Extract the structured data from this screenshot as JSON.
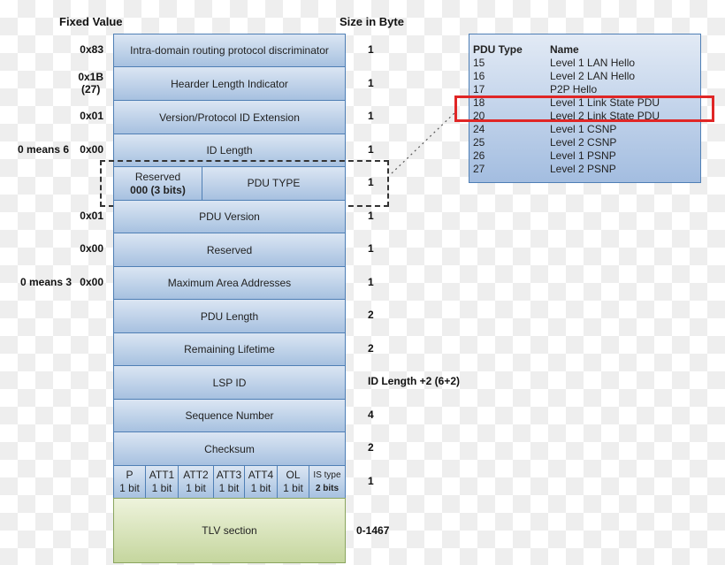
{
  "headers": {
    "fixed_value": "Fixed Value",
    "size_in_byte": "Size in Byte"
  },
  "fields": [
    {
      "name": "Intra-domain routing protocol discriminator",
      "fixed": "0x83",
      "size": "1"
    },
    {
      "name": "Hearder Length Indicator",
      "fixed": "0x1B",
      "fixed_sub": "(27)",
      "size": "1"
    },
    {
      "name": "Version/Protocol ID Extension",
      "fixed": "0x01",
      "size": "1"
    },
    {
      "name": "ID Length",
      "fixed": "0x00",
      "note": "0 means 6",
      "size": "1"
    },
    {
      "name": "PDU TYPE",
      "reserved_label": "Reserved",
      "reserved_value": "000 (3 bits)",
      "size": "1"
    },
    {
      "name": "PDU Version",
      "fixed": "0x01",
      "size": "1"
    },
    {
      "name": "Reserved",
      "fixed": "0x00",
      "size": "1"
    },
    {
      "name": "Maximum Area Addresses",
      "fixed": "0x00",
      "note": "0 means 3",
      "size": "1"
    },
    {
      "name": "PDU Length",
      "size": "2"
    },
    {
      "name": "Remaining Lifetime",
      "size": "2"
    },
    {
      "name": "LSP ID",
      "size": "ID Length +2 (6+2)"
    },
    {
      "name": "Sequence Number",
      "size": "4"
    },
    {
      "name": "Checksum",
      "size": "2"
    }
  ],
  "bit_fields": {
    "size": "1",
    "cells": [
      {
        "name": "P",
        "bits": "1 bit"
      },
      {
        "name": "ATT1",
        "bits": "1 bit"
      },
      {
        "name": "ATT2",
        "bits": "1 bit"
      },
      {
        "name": "ATT3",
        "bits": "1 bit"
      },
      {
        "name": "ATT4",
        "bits": "1 bit"
      },
      {
        "name": "OL",
        "bits": "1 bit"
      },
      {
        "name": "IS type",
        "bits": "2 bits"
      }
    ]
  },
  "tlv": {
    "name": "TLV section",
    "size": "0-1467"
  },
  "pdu_table": {
    "headers": [
      "PDU Type",
      "Name"
    ],
    "rows": [
      [
        "15",
        "Level 1 LAN Hello"
      ],
      [
        "16",
        "Level 2 LAN Hello"
      ],
      [
        "17",
        "P2P Hello"
      ],
      [
        "18",
        "Level 1 Link State PDU"
      ],
      [
        "20",
        "Level 2 Link State PDU"
      ],
      [
        "24",
        "Level 1 CSNP"
      ],
      [
        "25",
        "Level 2 CSNP"
      ],
      [
        "26",
        "Level 1 PSNP"
      ],
      [
        "27",
        "Level 2 PSNP"
      ]
    ],
    "highlighted_rows": [
      "18",
      "20"
    ],
    "highlight_color": "#e02626"
  },
  "colors": {
    "field_border": "#4f7fb5",
    "tlv_border": "#8aa55e"
  }
}
